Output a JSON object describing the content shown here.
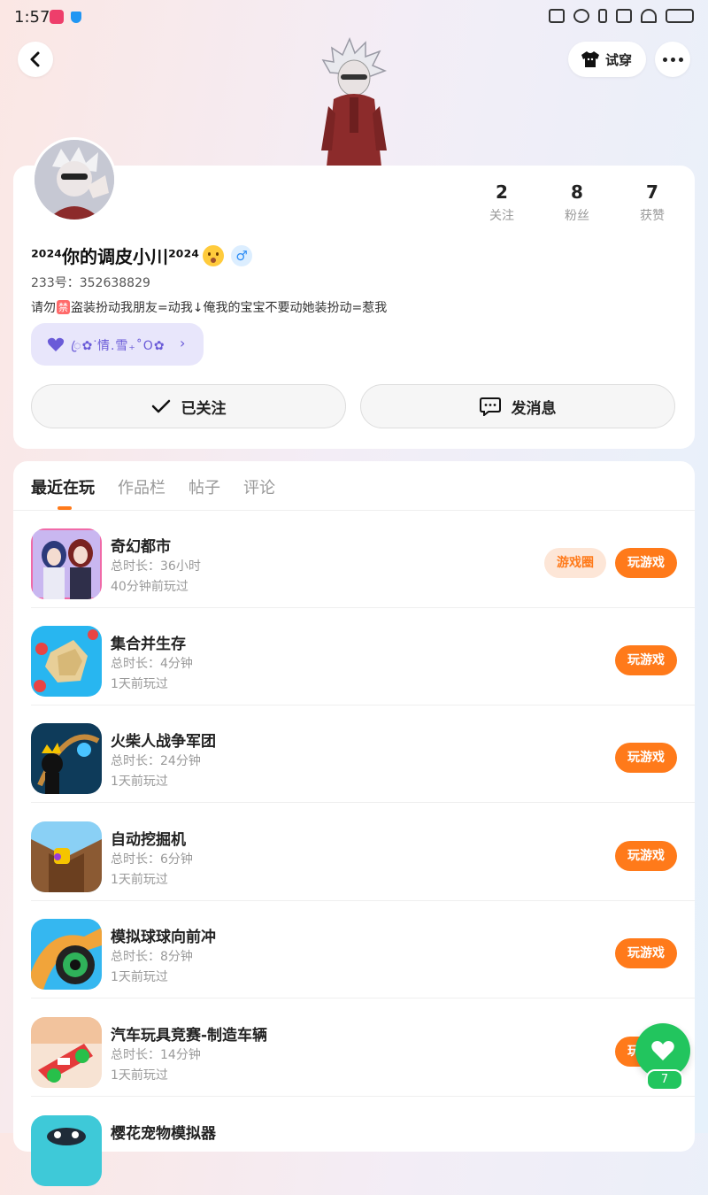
{
  "status_bar": {
    "time": "1:57"
  },
  "header": {
    "try_on_label": "试穿"
  },
  "profile": {
    "stats": [
      {
        "value": "2",
        "label": "关注"
      },
      {
        "value": "8",
        "label": "粉丝"
      },
      {
        "value": "7",
        "label": "获赞"
      }
    ],
    "nickname": "²⁰²⁴你的调皮小川²⁰²⁴",
    "gender_symbol": "♂",
    "uid_label": "233号：",
    "uid_value": "352638829",
    "bio_before": "请勿",
    "bio_badge": "禁",
    "bio_after": "盗装扮动我朋友=动我↓俺我的宝宝不要动她装扮动=惹我",
    "guild_name": "ꦿ✿ᐝ情.雪₊˚O✿",
    "following_label": "已关注",
    "message_label": "发消息"
  },
  "tabs": [
    "最近在玩",
    "作品栏",
    "帖子",
    "评论"
  ],
  "games": [
    {
      "name": "奇幻都市",
      "duration": "总时长：36小时",
      "last_played": "40分钟前玩过",
      "circle": "游戏圈",
      "play": "玩游戏"
    },
    {
      "name": "集合并生存",
      "duration": "总时长：4分钟",
      "last_played": "1天前玩过",
      "play": "玩游戏"
    },
    {
      "name": "火柴人战争军团",
      "duration": "总时长：24分钟",
      "last_played": "1天前玩过",
      "play": "玩游戏"
    },
    {
      "name": "自动挖掘机",
      "duration": "总时长：6分钟",
      "last_played": "1天前玩过",
      "play": "玩游戏"
    },
    {
      "name": "模拟球球向前冲",
      "duration": "总时长：8分钟",
      "last_played": "1天前玩过",
      "play": "玩游戏"
    },
    {
      "name": "汽车玩具竞赛-制造车辆",
      "duration": "总时长：14分钟",
      "last_played": "1天前玩过",
      "play": "玩游戏"
    },
    {
      "name": "樱花宠物模拟器",
      "duration": "",
      "last_played": "",
      "play": ""
    }
  ],
  "float_like": {
    "count": "7"
  },
  "colors": {
    "accent": "#ff7a1a",
    "like_green": "#22c55e",
    "guild_purple": "#6a5bd8"
  }
}
